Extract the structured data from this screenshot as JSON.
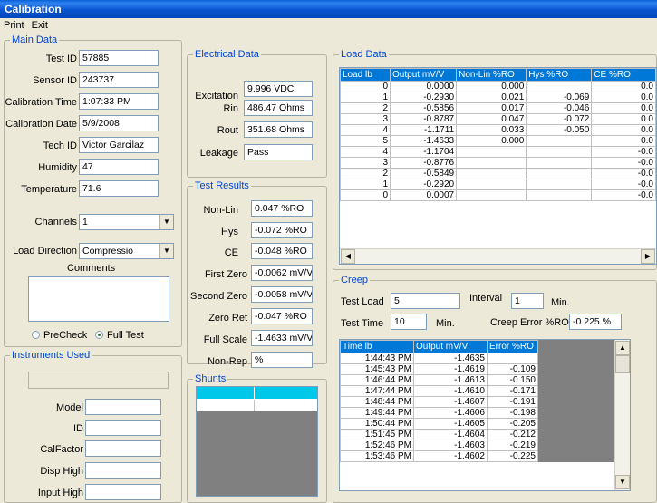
{
  "window": {
    "title": "Calibration"
  },
  "menu": {
    "print": "Print",
    "exit": "Exit"
  },
  "main_data": {
    "title": "Main Data",
    "test_id_label": "Test ID",
    "test_id": "57885",
    "sensor_id_label": "Sensor ID",
    "sensor_id": "243737",
    "cal_time_label": "Calibration Time",
    "cal_time": "1:07:33 PM",
    "cal_date_label": "Calibration Date",
    "cal_date": "5/9/2008",
    "tech_id_label": "Tech ID",
    "tech_id": "Victor Garcilaz",
    "humidity_label": "Humidity",
    "humidity": "47",
    "temperature_label": "Temperature",
    "temperature": "71.6",
    "channels_label": "Channels",
    "channels": "1",
    "load_dir_label": "Load Direction",
    "load_dir": "Compressio",
    "comments_label": "Comments",
    "precheck_label": "PreCheck",
    "fulltest_label": "Full Test"
  },
  "instruments": {
    "title": "Instruments Used",
    "model_label": "Model",
    "id_label": "ID",
    "calfactor_label": "CalFactor",
    "disp_high_label": "Disp High",
    "input_high_label": "Input High"
  },
  "electrical": {
    "title": "Electrical Data",
    "excitation_label": "Excitation",
    "excitation": "9.996 VDC",
    "rin_label": "Rin",
    "rin": "486.47 Ohms",
    "rout_label": "Rout",
    "rout": "351.68 Ohms",
    "leakage_label": "Leakage",
    "leakage": "Pass"
  },
  "test_results": {
    "title": "Test Results",
    "nonlin_label": "Non-Lin",
    "nonlin": "0.047 %RO",
    "hys_label": "Hys",
    "hys": "-0.072 %RO",
    "ce_label": "CE",
    "ce": "-0.048 %RO",
    "first_zero_label": "First Zero",
    "first_zero": "-0.0062 mV/V",
    "second_zero_label": "Second Zero",
    "second_zero": "-0.0058 mV/V",
    "zero_ret_label": "Zero Ret",
    "zero_ret": "-0.047 %RO",
    "full_scale_label": "Full Scale",
    "full_scale": "-1.4633 mV/V",
    "nonrep_label": "Non-Rep",
    "nonrep": "%"
  },
  "shunts": {
    "title": "Shunts"
  },
  "load_data": {
    "title": "Load Data",
    "headers": [
      "Load lb",
      "Output mV/V",
      "Non-Lin %RO",
      "Hys %RO",
      "CE %RO"
    ],
    "rows": [
      [
        "0",
        "0.0000",
        "0.000",
        "",
        "0.0"
      ],
      [
        "1",
        "-0.2930",
        "0.021",
        "-0.069",
        "0.0"
      ],
      [
        "2",
        "-0.5856",
        "0.017",
        "-0.046",
        "0.0"
      ],
      [
        "3",
        "-0.8787",
        "0.047",
        "-0.072",
        "0.0"
      ],
      [
        "4",
        "-1.1711",
        "0.033",
        "-0.050",
        "0.0"
      ],
      [
        "5",
        "-1.4633",
        "0.000",
        "",
        "0.0"
      ],
      [
        "4",
        "-1.1704",
        "",
        "",
        "-0.0"
      ],
      [
        "3",
        "-0.8776",
        "",
        "",
        "-0.0"
      ],
      [
        "2",
        "-0.5849",
        "",
        "",
        "-0.0"
      ],
      [
        "1",
        "-0.2920",
        "",
        "",
        "-0.0"
      ],
      [
        "0",
        "0.0007",
        "",
        "",
        "-0.0"
      ]
    ]
  },
  "creep": {
    "title": "Creep",
    "test_load_label": "Test Load",
    "test_load": "5",
    "interval_label": "Interval",
    "interval": "1",
    "interval_unit": "Min.",
    "test_time_label": "Test Time",
    "test_time": "10",
    "test_time_unit": "Min.",
    "creep_error_label": "Creep Error %RO",
    "creep_error": "-0.225 %",
    "headers": [
      "Time lb",
      "Output mV/V",
      "Error %RO"
    ],
    "rows": [
      [
        "1:44:43 PM",
        "-1.4635",
        ""
      ],
      [
        "1:45:43 PM",
        "-1.4619",
        "-0.109"
      ],
      [
        "1:46:44 PM",
        "-1.4613",
        "-0.150"
      ],
      [
        "1:47:44 PM",
        "-1.4610",
        "-0.171"
      ],
      [
        "1:48:44 PM",
        "-1.4607",
        "-0.191"
      ],
      [
        "1:49:44 PM",
        "-1.4606",
        "-0.198"
      ],
      [
        "1:50:44 PM",
        "-1.4605",
        "-0.205"
      ],
      [
        "1:51:45 PM",
        "-1.4604",
        "-0.212"
      ],
      [
        "1:52:46 PM",
        "-1.4603",
        "-0.219"
      ],
      [
        "1:53:46 PM",
        "-1.4602",
        "-0.225"
      ]
    ]
  },
  "icons": {
    "combo_arrow": "chevron-down-icon",
    "scroll_left": "arrow-left-icon",
    "scroll_right": "arrow-right-icon",
    "scroll_up": "arrow-up-icon",
    "scroll_down": "arrow-down-icon"
  },
  "colors": {
    "title_bar": "#0a55d0",
    "group_title": "#0046d5",
    "grid_header": "#0078d8",
    "grid_empty": "#808080",
    "shunt_header": "#00c8e8"
  }
}
